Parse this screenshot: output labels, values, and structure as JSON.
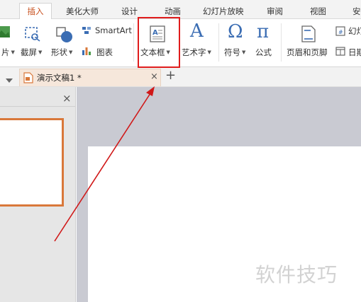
{
  "ribbon_tabs": [
    {
      "label": "插入"
    },
    {
      "label": "美化大师"
    },
    {
      "label": "设计"
    },
    {
      "label": "动画"
    },
    {
      "label": "幻灯片放映"
    },
    {
      "label": "审阅"
    },
    {
      "label": "视图"
    },
    {
      "label": "安"
    }
  ],
  "ribbon": {
    "partial_left": "片",
    "screenshot": "截屏",
    "shape": "形状",
    "smartart": "SmartArt",
    "chart": "图表",
    "textbox": "文本框",
    "wordart": "艺术字",
    "symbol": "符号",
    "formula": "公式",
    "header_footer": "页眉和页脚",
    "slide_number": "幻灯",
    "date_time": "日期",
    "symbol_glyph": "Ω",
    "formula_glyph": "π",
    "wordart_glyph": "A"
  },
  "document_tab": {
    "title": "演示文稿1 *",
    "close_glyph": "×",
    "new_tab_glyph": "+"
  },
  "pane": {
    "close_glyph": "×"
  },
  "watermark": "软件技巧",
  "colors": {
    "active_tab": "#c8501e",
    "annotation": "#e01c1c",
    "thumb_border": "#d9783a",
    "doc_tab_bg": "#f6e7db",
    "icon_blue": "#3b6db3"
  }
}
